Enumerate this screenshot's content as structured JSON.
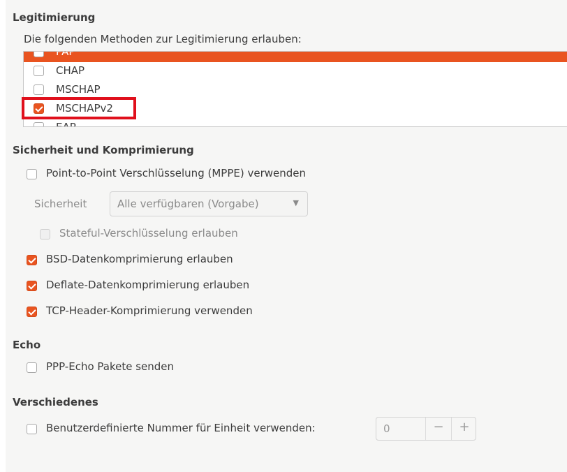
{
  "auth": {
    "title": "Legitimierung",
    "prompt": "Die folgenden Methoden zur Legitimierung erlauben:",
    "methods": [
      {
        "label": "PAP",
        "checked": false
      },
      {
        "label": "CHAP",
        "checked": false
      },
      {
        "label": "MSCHAP",
        "checked": false
      },
      {
        "label": "MSCHAPv2",
        "checked": true
      },
      {
        "label": "EAP",
        "checked": false
      }
    ]
  },
  "security": {
    "title": "Sicherheit und Komprimierung",
    "mppe_label": "Point-to-Point Verschlüsselung (MPPE) verwenden",
    "security_label": "Sicherheit",
    "security_value": "Alle verfügbaren (Vorgabe)",
    "stateful_label": "Stateful-Verschlüsselung erlauben",
    "bsd_label": "BSD-Datenkomprimierung erlauben",
    "deflate_label": "Deflate-Datenkomprimierung erlauben",
    "tcp_label": "TCP-Header-Komprimierung verwenden"
  },
  "echo": {
    "title": "Echo",
    "ppp_echo_label": "PPP-Echo Pakete senden"
  },
  "misc": {
    "title": "Verschiedenes",
    "unit_label": "Benutzerdefinierte Nummer für Einheit verwenden:",
    "unit_value": "0",
    "minus": "−",
    "plus": "+"
  },
  "colors": {
    "accent": "#e95420",
    "highlight": "#e0101c"
  }
}
